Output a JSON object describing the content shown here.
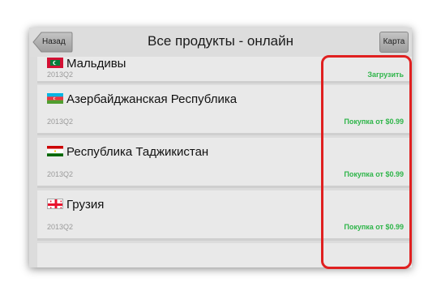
{
  "header": {
    "back_label": "Назад",
    "title": "Все продукты - онлайн",
    "map_label": "Карта"
  },
  "items": [
    {
      "country": "Мальдивы",
      "version": "2013Q2",
      "action": "Загрузить",
      "flag": "maldives-flag-icon"
    },
    {
      "country": "Азербайджанская Республика",
      "version": "2013Q2",
      "action": "Покупка от $0.99",
      "flag": "azerbaijan-flag-icon"
    },
    {
      "country": "Республика Таджикистан",
      "version": "2013Q2",
      "action": "Покупка от $0.99",
      "flag": "tajikistan-flag-icon"
    },
    {
      "country": "Грузия",
      "version": "2013Q2",
      "action": "Покупка от $0.99",
      "flag": "georgia-flag-icon"
    }
  ],
  "colors": {
    "action_green": "#2fb54a",
    "highlight_red": "#e02020"
  }
}
